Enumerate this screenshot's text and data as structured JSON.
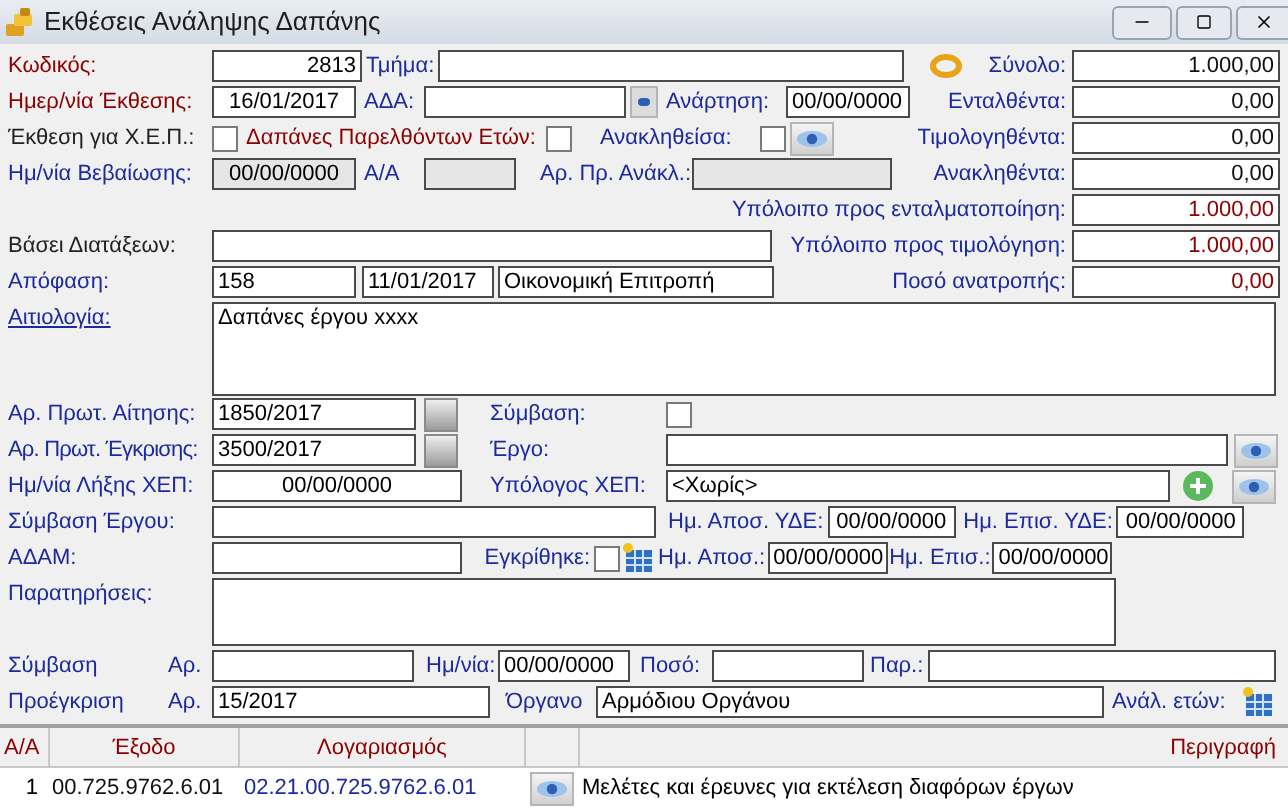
{
  "window": {
    "title": "Εκθέσεις Ανάληψης Δαπάνης"
  },
  "header": {
    "code_label": "Κωδικός:",
    "code": "2813",
    "department_label": "Τμήμα:",
    "report_date_label": "Ημερ/νία Έκθεσης:",
    "report_date": "16/01/2017",
    "ada_label": "ΑΔΑ:",
    "posting_label": "Ανάρτηση:",
    "posting_date": "00/00/0000",
    "xep_label": "Έκθεση για Χ.Ε.Π.:",
    "xep_checked": false,
    "past_years_label": "Δαπάνες Παρελθόντων Ετών:",
    "past_years_checked": false,
    "revoked_label": "Ανακληθείσα:",
    "revoked_checked": false,
    "confirm_date_label": "Ημ/νία Βεβαίωσης:",
    "confirm_date": "00/00/0000",
    "aa_label": "Α/Α",
    "revoke_no_label": "Αρ. Πρ. Ανάκλ.:",
    "provisions_label": "Βάσει Διατάξεων:",
    "decision_label": "Απόφαση:",
    "decision_no": "158",
    "decision_date": "11/01/2017",
    "decision_body": "Οικονομική Επιτροπή"
  },
  "totals": [
    {
      "label": "Σύνολο:",
      "value": "1.000,00",
      "kind": "plain"
    },
    {
      "label": "Ενταλθέντα:",
      "value": "0,00",
      "kind": "plain"
    },
    {
      "label": "Τιμολογηθέντα:",
      "value": "0,00",
      "kind": "plain"
    },
    {
      "label": "Ανακληθέντα:",
      "value": "0,00",
      "kind": "plain"
    },
    {
      "label": "Υπόλοιπο προς ενταλματοποίηση:",
      "value": "1.000,00",
      "kind": "highlight"
    },
    {
      "label": "Υπόλοιπο προς τιμολόγηση:",
      "value": "1.000,00",
      "kind": "highlight"
    },
    {
      "label": "Ποσό ανατροπής:",
      "value": "0,00",
      "kind": "highlight"
    }
  ],
  "details": {
    "justification_label": "Αιτιολογία:",
    "justification": "Δαπάνες έργου xxxx",
    "request_no_label": "Αρ. Πρωτ. Αίτησης:",
    "request_no": "1850/2017",
    "contract_label": "Σύμβαση:",
    "contract_checked": false,
    "approval_no_label": "Αρ. Πρωτ. Έγκρισης:",
    "approval_no": "3500/2017",
    "project_label": "Έργο:",
    "xep_end_label": "Ημ/νία Λήξης ΧΕΠ:",
    "xep_end": "00/00/0000",
    "xep_holder_label": "Υπόλογος ΧΕΠ:",
    "xep_holder": "<Χωρίς>",
    "project_contract_label": "Σύμβαση Έργου:",
    "yde_send_label": "Ημ. Αποσ. ΥΔΕ:",
    "yde_send": "00/00/0000",
    "yde_return_label": "Ημ. Επισ. ΥΔΕ:",
    "yde_return": "00/00/0000",
    "adam_label": "ΑΔΑΜ:",
    "approved_label": "Εγκρίθηκε:",
    "approved_checked": false,
    "send_label": "Ημ. Αποσ.:",
    "send": "00/00/0000",
    "return_label": "Ημ. Επισ.:",
    "return": "00/00/0000",
    "notes_label": "Παρατηρήσεις:"
  },
  "contract": {
    "label": "Σύμβαση",
    "no_label": "Αρ.",
    "date_label": "Ημ/νία:",
    "date": "00/00/0000",
    "amount_label": "Ποσό:",
    "ref_label": "Παρ.:"
  },
  "preapproval": {
    "label": "Προέγκριση",
    "no_label": "Αρ.",
    "no": "15/2017",
    "body_label": "Όργανο",
    "body": "Αρμόδιου Οργάνου",
    "years_label": "Ανάλ. ετών:"
  },
  "table": {
    "columns": [
      "Α/Α",
      "Έξοδο",
      "Λογαριασμός",
      "Περιγραφή"
    ],
    "rows": [
      {
        "aa": "1",
        "expense": "00.725.9762.6.01",
        "account": "02.21.00.725.9762.6.01",
        "description": "Μελέτες και έρευνες για εκτέλεση διαφόρων έργων"
      }
    ]
  }
}
